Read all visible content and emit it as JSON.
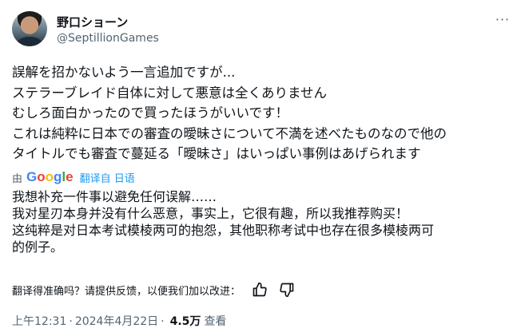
{
  "user": {
    "display_name": "野口ショーン",
    "handle": "@SeptillionGames"
  },
  "menu": {
    "more_icon": "more-horizontal-icon",
    "more_glyph": "···"
  },
  "tweet": {
    "lines": [
      "誤解を招かないよう一言追加ですが...",
      "ステラーブレイド自体に対して悪意は全くありません",
      "むしろ面白かったので買ったほうがいいです！",
      "これは純粋に日本での審査の曖昧さについて不満を述べたものなので他の",
      "タイトルでも審査で蔓延る「曖昧さ」はいっぱい事例はあげられます"
    ]
  },
  "translation": {
    "by_label": "由",
    "provider": "Google",
    "link_label": "翻译自 日语",
    "lines": [
      "我想补充一件事以避免任何误解……",
      "我对星刃本身并没有什么恶意，事实上，它很有趣，所以我推荐购买！",
      "这纯粹是对日本考试模棱两可的抱怨，其他职称考试中也存在很多模棱两可",
      "的例子。"
    ]
  },
  "feedback": {
    "question": "翻译得准确吗？请提供反馈，以便我们加以改进：",
    "thumbs_up_icon": "thumbs-up-icon",
    "thumbs_down_icon": "thumbs-down-icon"
  },
  "meta": {
    "time": "上午12:31",
    "separator1": "·",
    "date": "2024年4月22日",
    "separator2": "·",
    "views_count": "4.5万",
    "views_label": "查看"
  }
}
